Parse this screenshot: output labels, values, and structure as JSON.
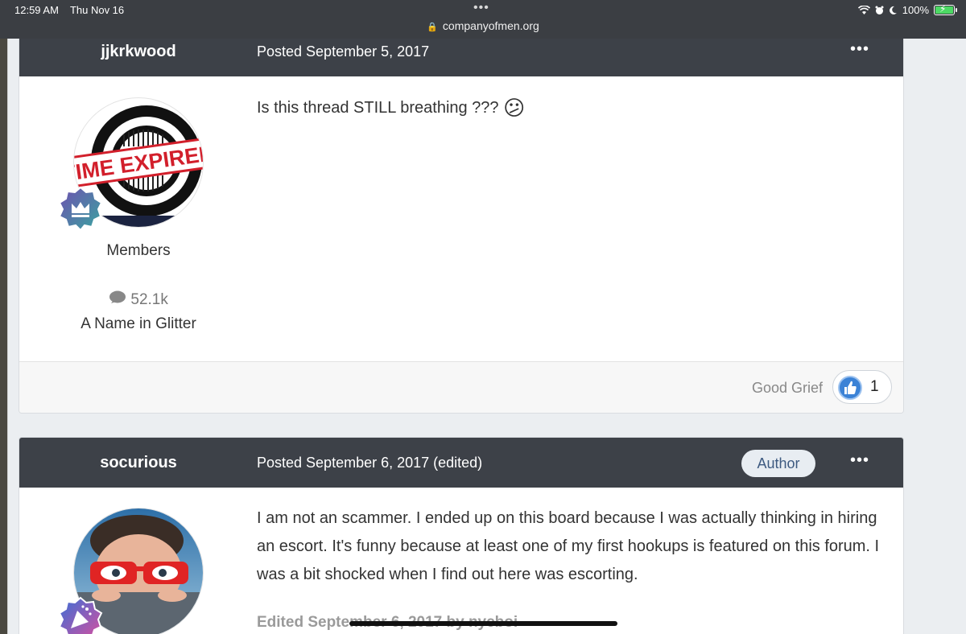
{
  "status_bar": {
    "time": "12:59 AM",
    "date": "Thu Nov 16",
    "url": "companyofmen.org",
    "battery": "100%",
    "icons": [
      "wifi-icon",
      "alarm-icon",
      "moon-icon",
      "battery-icon"
    ]
  },
  "posts": [
    {
      "author": "jjkrkwood",
      "posted": "Posted September 5, 2017",
      "avatar_text": "TIME EXPIRED",
      "group": "Members",
      "post_count": "52.1k",
      "member_title": "A Name in Glitter",
      "content": "Is this thread STILL breathing ???",
      "emoji": "😕",
      "reaction_label": "Good Grief",
      "reaction_count": "1"
    },
    {
      "author": "socurious",
      "posted": "Posted September 6, 2017 (edited)",
      "badge": "Author",
      "content": "I am not an scammer. I ended up on this board because I was actually thinking in hiring an escort. It's funny because at least one of my first hookups is featured on this forum. I was a bit shocked when I find out here was escorting.",
      "edited_note": "Edited September 6, 2017 by nycboi"
    }
  ],
  "colors": {
    "header_bg": "#3d4148",
    "page_bg": "#ebeef1",
    "badge_bg": "#e8edf2",
    "reaction_blue": "#3b82d6",
    "rank_purple": "#6e4fb0"
  }
}
